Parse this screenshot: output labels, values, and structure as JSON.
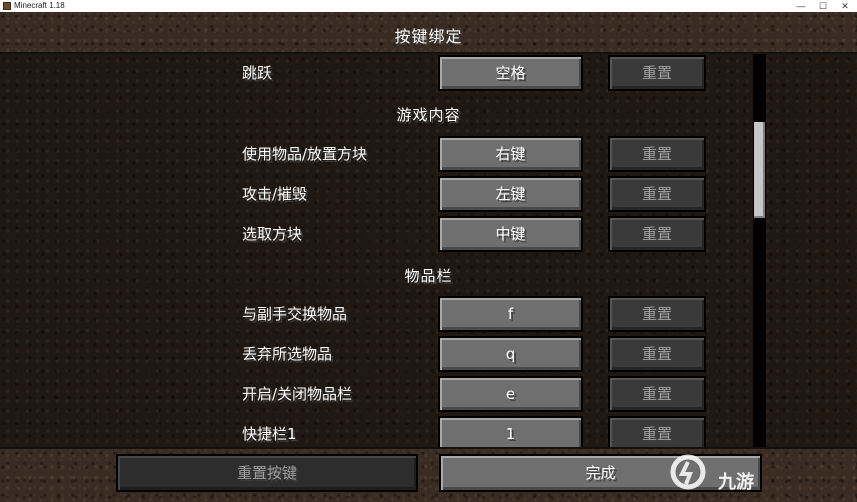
{
  "window": {
    "title": "Minecraft 1.18",
    "minimize": "—",
    "maximize": "☐",
    "close": "✕"
  },
  "screen": {
    "title": "按键绑定"
  },
  "rows": [
    {
      "type": "binding",
      "label": "跳跃",
      "key": "空格",
      "reset": "重置"
    },
    {
      "type": "section",
      "label": "游戏内容"
    },
    {
      "type": "binding",
      "label": "使用物品/放置方块",
      "key": "右键",
      "reset": "重置"
    },
    {
      "type": "binding",
      "label": "攻击/摧毁",
      "key": "左键",
      "reset": "重置"
    },
    {
      "type": "binding",
      "label": "选取方块",
      "key": "中键",
      "reset": "重置"
    },
    {
      "type": "section",
      "label": "物品栏"
    },
    {
      "type": "binding",
      "label": "与副手交换物品",
      "key": "f",
      "reset": "重置"
    },
    {
      "type": "binding",
      "label": "丢弃所选物品",
      "key": "q",
      "reset": "重置"
    },
    {
      "type": "binding",
      "label": "开启/关闭物品栏",
      "key": "e",
      "reset": "重置"
    },
    {
      "type": "binding",
      "label": "快捷栏1",
      "key": "1",
      "reset": "重置"
    }
  ],
  "footer": {
    "reset_all_label": "重置按键",
    "done_label": "完成"
  },
  "watermark": {
    "text": "九游"
  },
  "colors": {
    "button": "#6f6f6f",
    "button_disabled": "#3a3a3a",
    "text": "#ffffff",
    "text_disabled": "#a0a0a0"
  }
}
